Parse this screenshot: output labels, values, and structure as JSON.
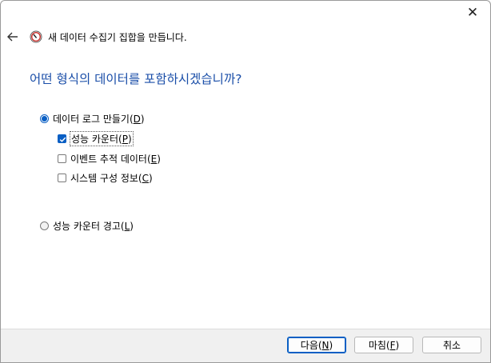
{
  "window": {
    "close_glyph": "✕"
  },
  "header": {
    "title": "새 데이터 수집기 집합을 만듭니다."
  },
  "question": "어떤 형식의 데이터를 포함하시겠습니까?",
  "options": {
    "create_logs": {
      "label": "데이터 로그 만들기(",
      "key": "D",
      "suffix": ")",
      "selected": true
    },
    "perf_counter": {
      "label": "성능 카운터(",
      "key": "P",
      "suffix": ")",
      "checked": true
    },
    "event_trace": {
      "label": "이벤트 추적 데이터(",
      "key": "E",
      "suffix": ")",
      "checked": false
    },
    "sys_config": {
      "label": "시스템 구성 정보(",
      "key": "C",
      "suffix": ")",
      "checked": false
    },
    "perf_alert": {
      "label": "성능 카운터 경고(",
      "key": "L",
      "suffix": ")",
      "selected": false
    }
  },
  "buttons": {
    "next": {
      "label": "다음(",
      "key": "N",
      "suffix": ")"
    },
    "finish": {
      "label": "마침(",
      "key": "F",
      "suffix": ")"
    },
    "cancel": {
      "label": "취소"
    }
  },
  "colors": {
    "accent": "#0a5fc4",
    "question": "#1a4ea8"
  }
}
